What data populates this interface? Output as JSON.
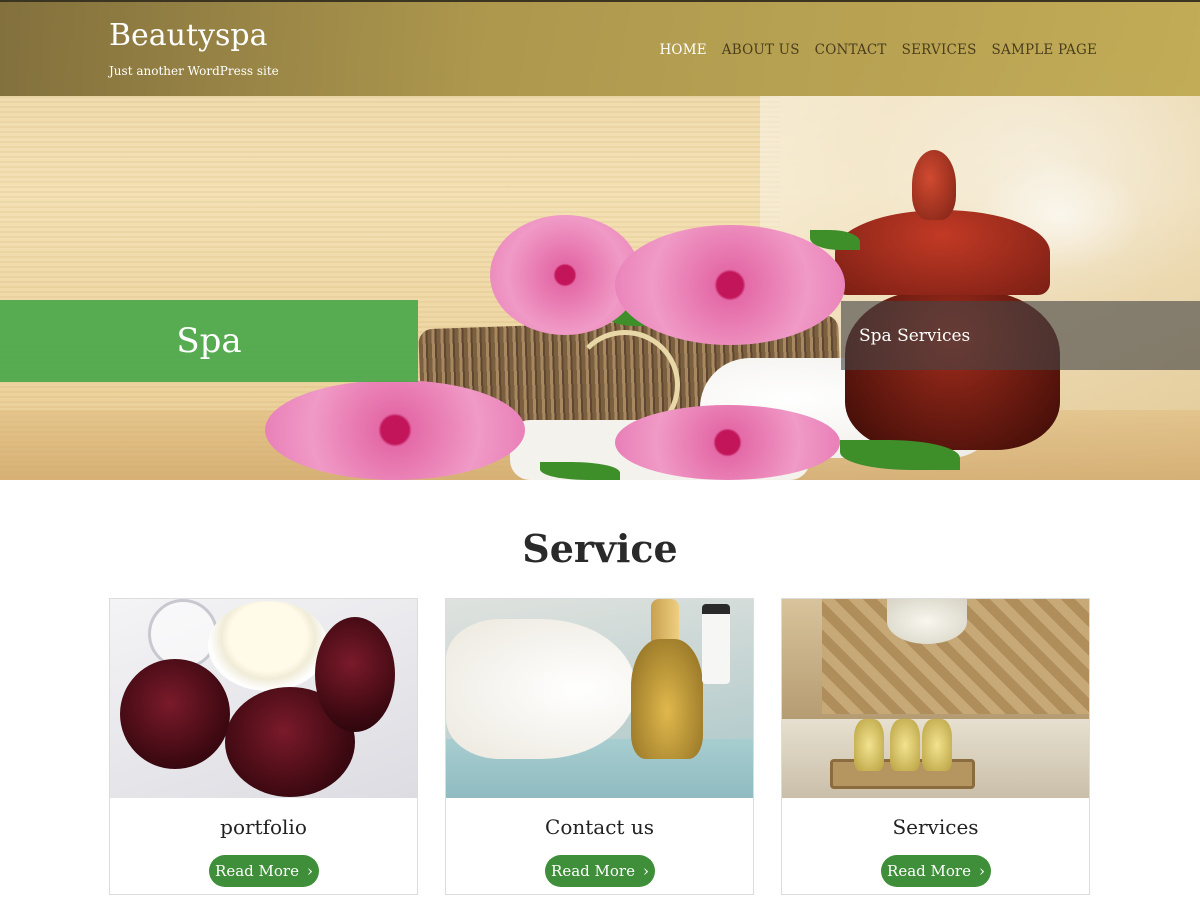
{
  "header": {
    "site_title": "Beautyspa",
    "tagline": "Just another WordPress site",
    "nav": [
      {
        "label": "HOME",
        "active": true
      },
      {
        "label": "ABOUT US",
        "active": false
      },
      {
        "label": "CONTACT",
        "active": false
      },
      {
        "label": "SERVICES",
        "active": false
      },
      {
        "label": "SAMPLE PAGE",
        "active": false
      }
    ]
  },
  "hero": {
    "label_left": "Spa",
    "label_right": "Spa Services"
  },
  "service": {
    "title": "Service",
    "cards": [
      {
        "title": "portfolio",
        "button": "Read More",
        "icon": "chevron-right-icon"
      },
      {
        "title": "Contact us",
        "button": "Read More",
        "icon": "chevron-right-icon"
      },
      {
        "title": "Services",
        "button": "Read More",
        "icon": "chevron-right-icon"
      }
    ]
  },
  "colors": {
    "header_bg": "#a8924a",
    "hero_green": "#4aa84a",
    "button_green": "#3f8e3a",
    "nav_active": "#ffffff",
    "nav_inactive": "#4a3e1c"
  }
}
